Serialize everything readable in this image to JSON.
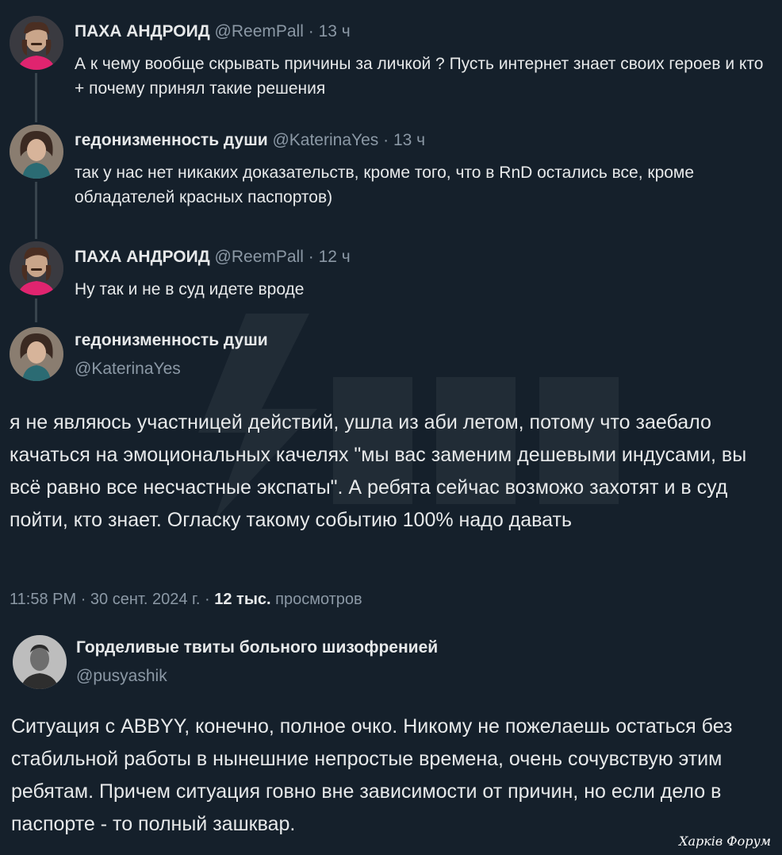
{
  "thread": [
    {
      "name": "ПАХА АНДРОИД",
      "handle": "@ReemPall",
      "dot": "·",
      "time": "13 ч",
      "text": "А к чему вообще скрывать причины за личкой ? Пусть интернет знает своих героев и кто + почему принял такие решения"
    },
    {
      "name": "гедонизменность души",
      "handle": "@KaterinaYes",
      "dot": "·",
      "time": "13 ч",
      "text": "так у нас нет никаких доказательств, кроме того, что в RnD остались все, кроме обладателей красных паспортов)"
    },
    {
      "name": "ПАХА АНДРОИД",
      "handle": "@ReemPall",
      "dot": "·",
      "time": "12 ч",
      "text": "Ну так и не в суд идете вроде"
    }
  ],
  "main_tweet": {
    "name": "гедонизменность души",
    "handle": "@KaterinaYes",
    "text": "я не являюсь участницей действий, ушла из аби летом, потому что заебало качаться на эмоциональных качелях \"мы вас заменим дешевыми индусами, вы всё равно все несчастные экспаты\". А ребята сейчас возможо захотят и в суд пойти, кто знает. Огласку такому событию 100% надо давать",
    "time": "11:58 PM",
    "dot": "·",
    "date": "30 сент. 2024 г.",
    "views_count": "12 тыс.",
    "views_label": "просмотров"
  },
  "second_tweet": {
    "name": "Горделивые твиты больного шизофренией",
    "handle": "@pusyashik",
    "text": "Ситуация с ABBYY, конечно, полное очко. Никому не пожелаешь остаться без стабильной работы в нынешние непростые времена, очень сочувствую этим ребятам. Причем ситуация говно вне зависимости от причин, но если дело в паспорте - то полный зашквар."
  },
  "corner_watermark": "Харків Форум",
  "colors": {
    "background": "#15202b",
    "text": "#e7e9ea",
    "secondary": "#8b98a5",
    "thread_line": "#38444d",
    "avatar_accent": "#e0246f"
  }
}
